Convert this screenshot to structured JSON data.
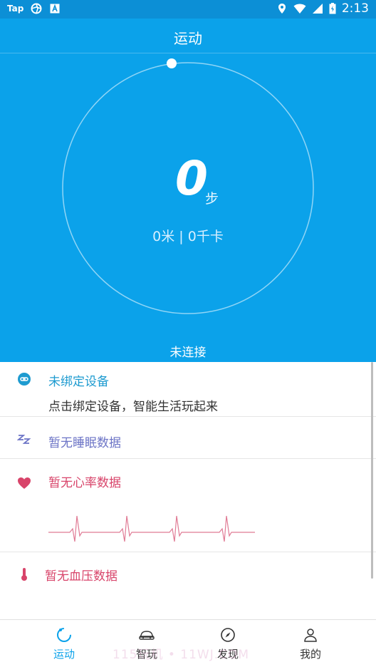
{
  "status_bar": {
    "left_label": "Tap",
    "time": "2:13",
    "icons": [
      "aperture-icon",
      "a-box-icon",
      "location-icon",
      "wifi-icon",
      "signal-icon",
      "battery-charging-icon"
    ]
  },
  "header": {
    "title": "运动"
  },
  "activity": {
    "steps": "0",
    "steps_unit": "步",
    "stats": "0米 | 0千卡",
    "connection_status": "未连接",
    "progress": 0
  },
  "cards": {
    "device": {
      "title": "未绑定设备",
      "subtitle": "点击绑定设备，智能生活玩起来",
      "color": "#1e9bd0"
    },
    "sleep": {
      "title": "暂无睡眠数据",
      "color": "#6c74c6"
    },
    "heart": {
      "title": "暂无心率数据",
      "color": "#d8446a"
    },
    "blood_pressure": {
      "title": "暂无血压数据",
      "color": "#d8446a"
    }
  },
  "tabs": [
    {
      "label": "运动",
      "icon": "running-ring-icon",
      "active": true
    },
    {
      "label": "智玩",
      "icon": "car-icon",
      "active": false
    },
    {
      "label": "发现",
      "icon": "compass-icon",
      "active": false
    },
    {
      "label": "我的",
      "icon": "person-icon",
      "active": false
    }
  ],
  "watermark": "115玩机 • 11WJ.COM",
  "colors": {
    "accent": "#0ba2ea",
    "status_bar": "#0c8fd6"
  }
}
